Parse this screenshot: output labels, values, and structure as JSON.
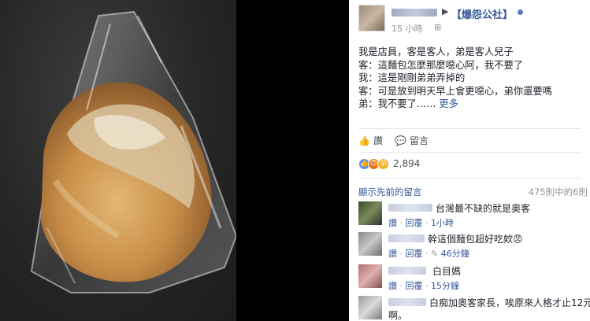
{
  "post": {
    "group_name": "【爆怨公社】",
    "timestamp": "15 小時",
    "lines": [
      "我是店員，客是客人，弟是客人兒子",
      "客：這麵包怎麼那麼噁心阿，我不要了",
      "我：這是剛剛弟弟弄掉的",
      "客：可是放到明天早上會更噁心，弟你還要嗎",
      "弟：我不要了……"
    ],
    "more_label": "更多"
  },
  "actions": {
    "like_label": "讚",
    "comment_label": "留言"
  },
  "reactions": {
    "count": "2,894"
  },
  "comments_header": {
    "prev_label": "顯示先前的留言",
    "count_label": "475則中的6則"
  },
  "comments": [
    {
      "text": "台灣最不缺的就是奧客",
      "like": "讚",
      "reply": "回覆",
      "time": "1小時"
    },
    {
      "text": "幹這個麵包超好吃欸😠",
      "like": "讚",
      "reply": "回覆",
      "time": "46分鐘"
    },
    {
      "text": "白目媽",
      "like": "讚",
      "reply": "回覆",
      "time": "15分鐘"
    },
    {
      "text_line1": "白痴加奧客家長，唉原來人格才止12元",
      "text_line2": "啊。"
    }
  ],
  "colors": {
    "link": "#365899",
    "meta": "#90949c",
    "like_reaction": "#5890ff",
    "angry_reaction": "#e9710f",
    "wow_reaction": "#f7b125"
  }
}
